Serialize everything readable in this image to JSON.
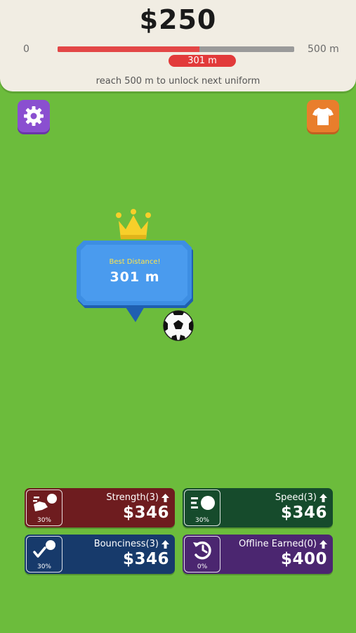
{
  "header": {
    "money": "$250",
    "range_min": "0",
    "range_max": "500 m",
    "progress": 0.6,
    "current_distance": "301 m",
    "unlock_hint": "reach 500 m to unlock next uniform"
  },
  "buttons": {
    "settings_icon": "gear-icon",
    "uniform_icon": "shirt-icon"
  },
  "best": {
    "title": "Best Distance!",
    "value": "301 m"
  },
  "upgrades": [
    {
      "label": "Strength(3)",
      "price": "$346",
      "percent": "30%",
      "icon": "kick-icon",
      "color": "#6e1c1f"
    },
    {
      "label": "Speed(3)",
      "price": "$346",
      "percent": "30%",
      "icon": "speed-ball-icon",
      "color": "#164b2c"
    },
    {
      "label": "Bounciness(3)",
      "price": "$346",
      "percent": "30%",
      "icon": "bounce-icon",
      "color": "#173a6b"
    },
    {
      "label": "Offline Earned(0)",
      "price": "$400",
      "percent": "0%",
      "icon": "clock-icon",
      "color": "#4b2670"
    }
  ],
  "colors": {
    "field": "#6cbc3c",
    "progress_fill": "#e34747",
    "accent_yellow": "#ffe44a"
  }
}
